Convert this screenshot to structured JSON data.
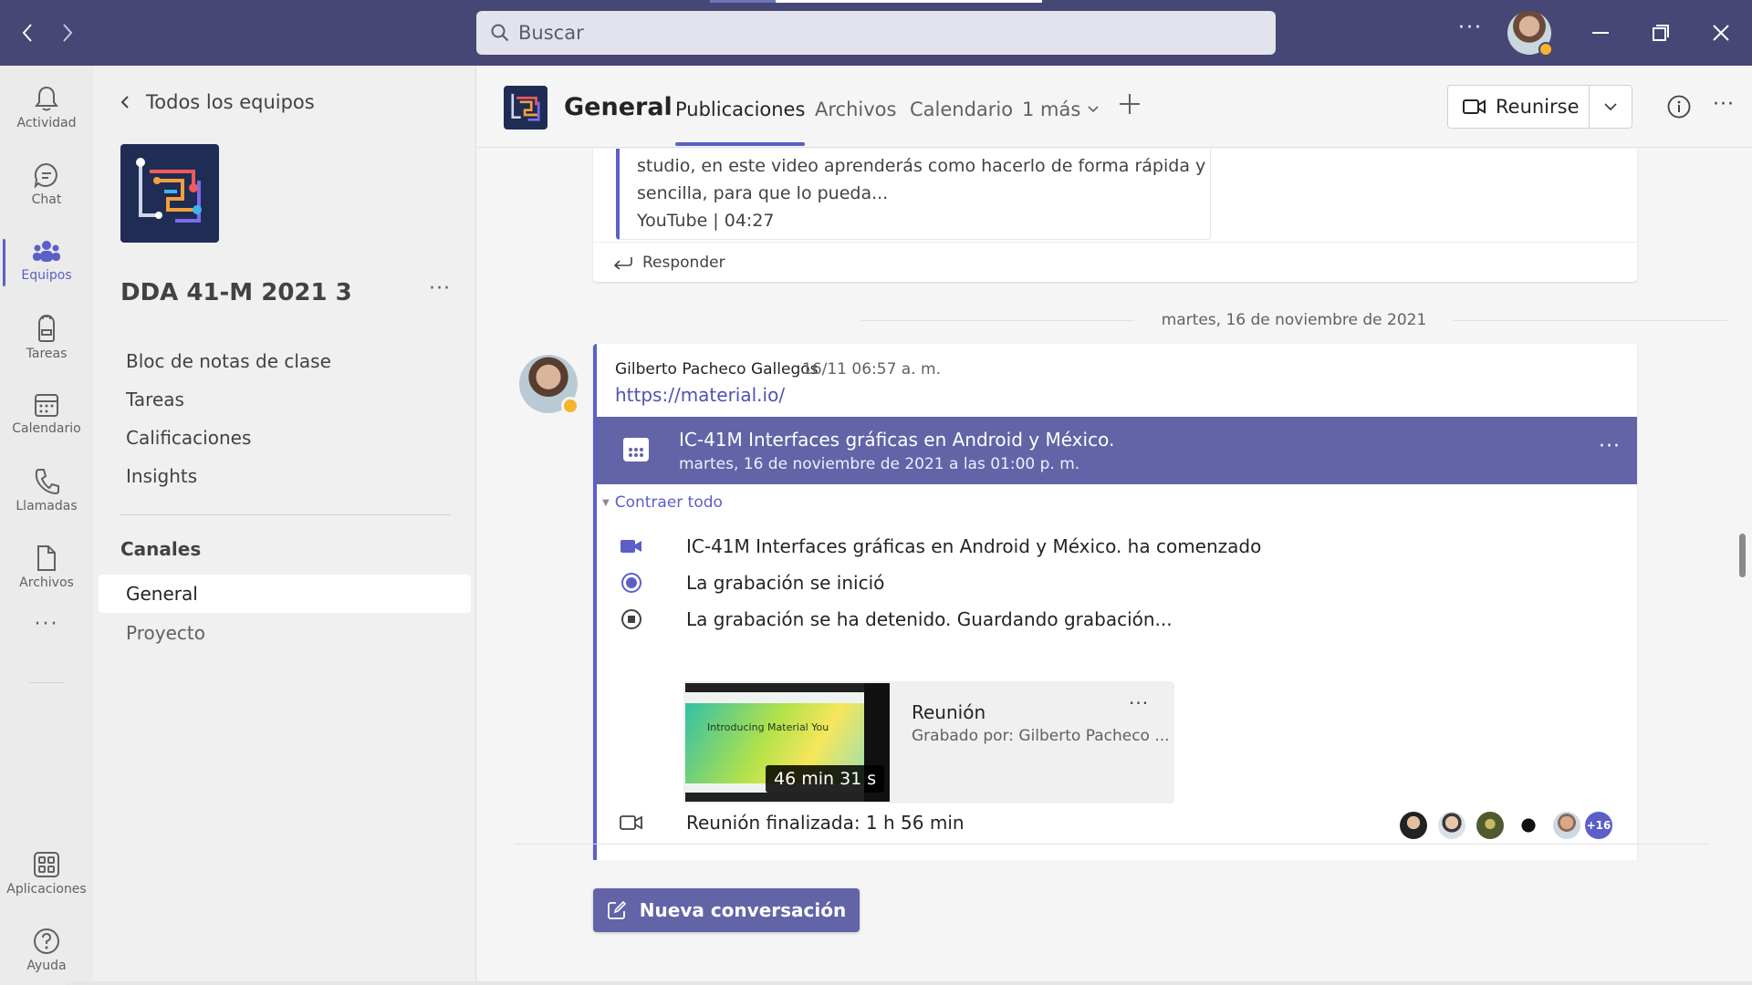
{
  "colors": {
    "titlebar": "#464775",
    "accent": "#5b5fc7",
    "banner": "#6264a7",
    "status_away": "#f8b32b"
  },
  "titlebar": {
    "search_placeholder": "Buscar",
    "more": "···"
  },
  "rail": {
    "items": [
      {
        "label": "Actividad",
        "icon": "bell-icon"
      },
      {
        "label": "Chat",
        "icon": "chat-icon"
      },
      {
        "label": "Equipos",
        "icon": "teams-icon"
      },
      {
        "label": "Tareas",
        "icon": "backpack-icon"
      },
      {
        "label": "Calendario",
        "icon": "calendar-icon"
      },
      {
        "label": "Llamadas",
        "icon": "phone-icon"
      },
      {
        "label": "Archivos",
        "icon": "file-icon"
      },
      {
        "label": "Aplicaciones",
        "icon": "apps-icon"
      },
      {
        "label": "Ayuda",
        "icon": "help-icon"
      }
    ],
    "more": "···"
  },
  "team_pane": {
    "back_label": "Todos los equipos",
    "team_name": "DDA 41-M 2021 3",
    "more": "···",
    "links": [
      "Bloc de notas de clase",
      "Tareas",
      "Calificaciones",
      "Insights"
    ],
    "channels_header": "Canales",
    "channels": [
      "General",
      "Proyecto"
    ]
  },
  "header": {
    "channel": "General",
    "tabs": [
      "Publicaciones",
      "Archivos",
      "Calendario",
      "1 más"
    ],
    "meet_label": "Reunirse",
    "more": "···"
  },
  "feed": {
    "prev_card": {
      "line1": "studio, en este video aprenderás como hacerlo de forma rápida y",
      "line2": "sencilla, para que lo pueda...",
      "meta": "YouTube | 04:27",
      "reply": "Responder"
    },
    "date_divider": "martes, 16 de noviembre de 2021",
    "post": {
      "author": "Gilberto Pacheco Gallegos",
      "time": "16/11 06:57 a. m.",
      "url": "https://material.io/",
      "meeting_title": "IC-41M Interfaces gráficas en Android y México.",
      "meeting_date": "martes, 16 de noviembre de 2021 a las 01:00 p. m.",
      "more": "···",
      "collapse_label": "Contraer todo",
      "events": [
        "IC-41M Interfaces gráficas en Android y México. ha comenzado",
        "La grabación se inició",
        "La grabación se ha detenido. Guardando grabación..."
      ],
      "recording": {
        "title": "Reunión",
        "by": "Grabado por: Gilberto Pacheco ...",
        "duration": "46 min 31 s",
        "thumb_text": "Introducing Material You",
        "more": "···"
      },
      "ended": "Reunión finalizada: 1 h 56 min",
      "participants_more": "+16"
    },
    "new_conversation": "Nueva conversación"
  }
}
